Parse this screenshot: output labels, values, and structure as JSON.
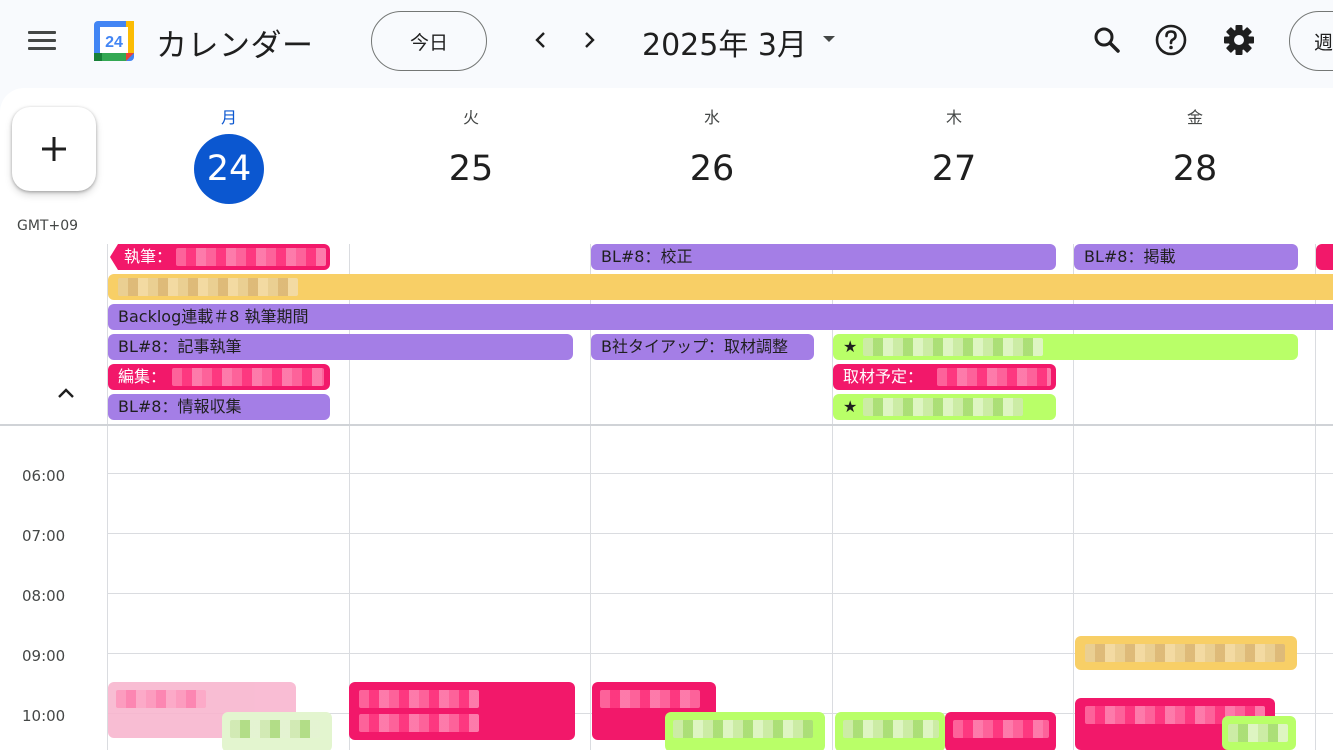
{
  "header": {
    "app_title": "カレンダー",
    "logo_day": "24",
    "today_label": "今日",
    "date_title": "2025年 3月",
    "view_label": "週"
  },
  "sidebar": {
    "timezone": "GMT+09"
  },
  "days": [
    {
      "dow": "月",
      "num": "24",
      "today": true
    },
    {
      "dow": "火",
      "num": "25",
      "today": false
    },
    {
      "dow": "水",
      "num": "26",
      "today": false
    },
    {
      "dow": "木",
      "num": "27",
      "today": false
    },
    {
      "dow": "金",
      "num": "28",
      "today": false
    }
  ],
  "allday_events": {
    "mon_shippitsu": "執筆：",
    "wed_kousei": "BL#8：校正",
    "fri_keisai": "BL#8：掲載",
    "backlog_period": "Backlog連載＃8 執筆期間",
    "mon_kiji": "BL#8：記事執筆",
    "wed_tieup": "B社タイアップ：取材調整",
    "thu_star1": "★",
    "mon_henshu": "編集：",
    "thu_shuzai": "取材予定：",
    "mon_joho": "BL#8：情報収集",
    "thu_star2": "★"
  },
  "times": [
    "06:00",
    "07:00",
    "08:00",
    "09:00",
    "10:00"
  ],
  "colors": {
    "today_blue": "#0b57d0",
    "event_purple": "#a47ee6",
    "event_pink": "#f2186a",
    "event_green": "#b9ff68",
    "event_yellow": "#f8cf66"
  }
}
